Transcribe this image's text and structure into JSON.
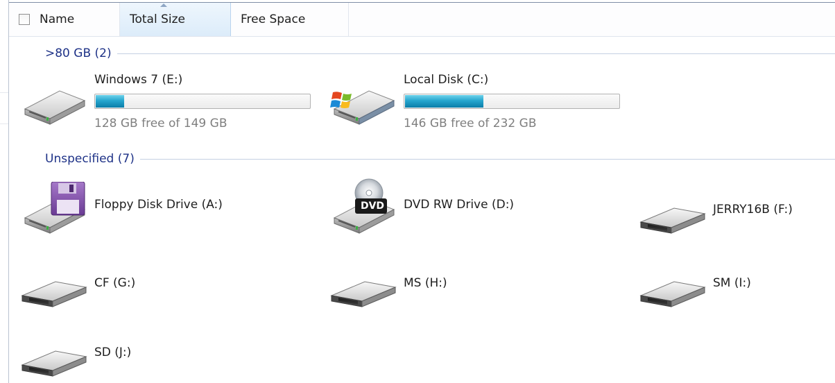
{
  "columns": {
    "name": "Name",
    "total_size": "Total Size",
    "free_space": "Free Space"
  },
  "groups": [
    {
      "label": ">80 GB (2)"
    },
    {
      "label": "Unspecified (7)"
    }
  ],
  "drives": [
    {
      "name": "Windows 7 (E:)",
      "free_text": "128 GB free of 149 GB",
      "used_fraction": 0.14,
      "icon": "hard-drive-icon"
    },
    {
      "name": "Local Disk (C:)",
      "free_text": "146 GB free of 232 GB",
      "used_fraction": 0.37,
      "icon": "windows-hard-drive-icon"
    },
    {
      "name": "Floppy Disk Drive (A:)",
      "icon": "floppy-drive-icon"
    },
    {
      "name": "DVD RW Drive (D:)",
      "icon": "dvd-drive-icon",
      "badge": "DVD"
    },
    {
      "name": "JERRY16B (F:)",
      "icon": "removable-drive-icon"
    },
    {
      "name": "CF (G:)",
      "icon": "removable-drive-icon"
    },
    {
      "name": "MS (H:)",
      "icon": "removable-drive-icon"
    },
    {
      "name": "SM (I:)",
      "icon": "removable-drive-icon"
    },
    {
      "name": "SD (J:)",
      "icon": "removable-drive-icon"
    }
  ],
  "colors": {
    "group_text": "#1e3287",
    "bar_fill": "#26a6ce",
    "free_text": "#7f7f7f",
    "dvd_badge": "#1a1a1a"
  }
}
